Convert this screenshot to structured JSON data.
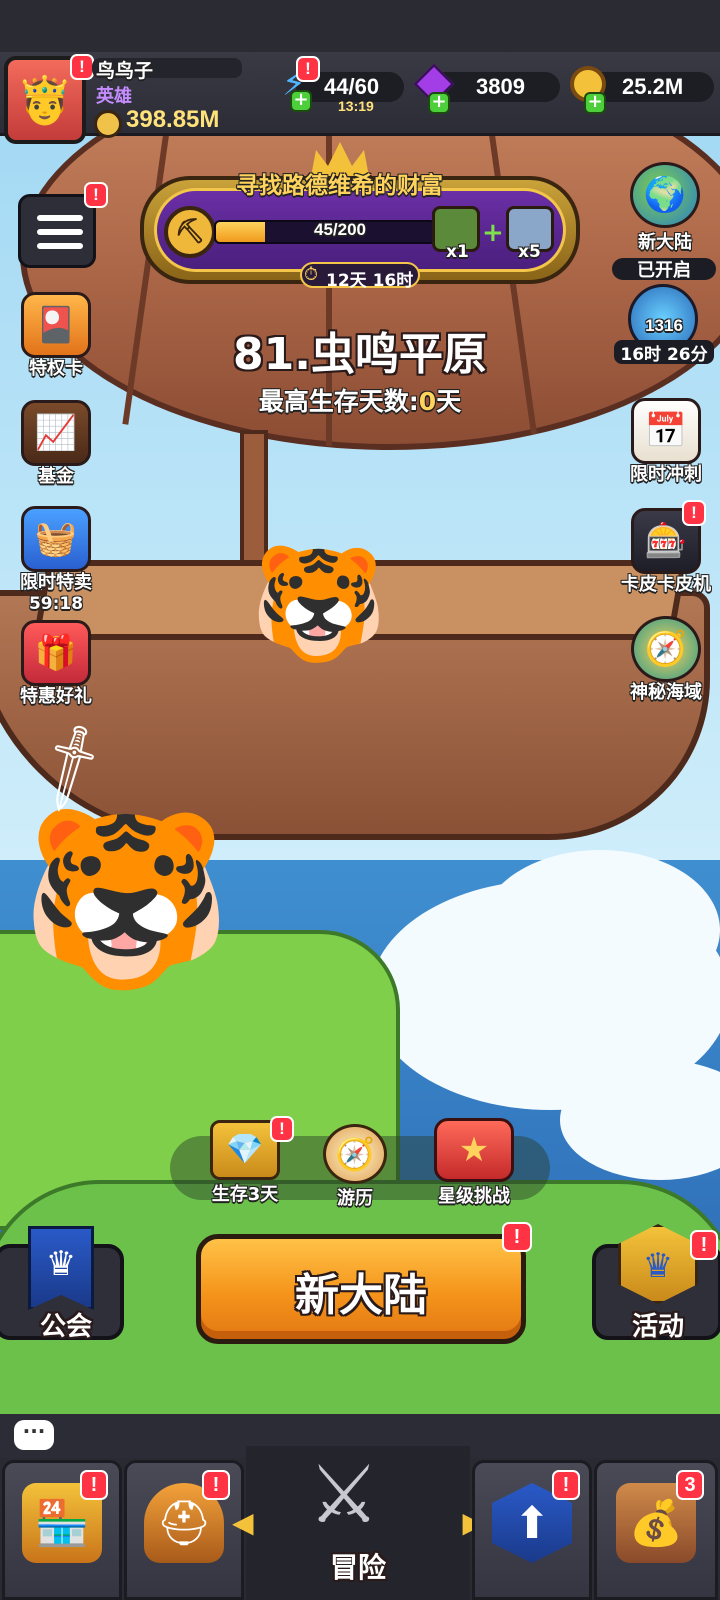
{
  "player": {
    "name": "鸟鸟子",
    "title": "英雄",
    "power": "398.85M"
  },
  "resources": {
    "energy": "44/60",
    "energy_timer": "13:19",
    "gems": "3809",
    "gold": "25.2M"
  },
  "quest": {
    "title": "寻找路德维希的财富",
    "progress_text": "45/200",
    "progress": 0.225,
    "reward1_count": "x1",
    "reward2_count": "x5",
    "timer": "12天 16时"
  },
  "stage": {
    "name": "81.虫鸣平原",
    "best_days_label": "最高生存天数:",
    "best_days_value": "0",
    "best_days_unit": "天"
  },
  "left_menu": {
    "privilege_card": "特权卡",
    "fund": "基金",
    "limited_sale": "限时特卖",
    "limited_sale_timer": "59:18",
    "special_gift": "特惠好礼"
  },
  "right_menu": {
    "new_continent": "新大陆",
    "new_continent_status": "已开启",
    "boss_count": "1316",
    "boss_timer": "16时 26分",
    "limited_sprint": "限时冲刺",
    "capybara_machine": "卡皮卡皮机",
    "mystic_sea": "神秘海域"
  },
  "actions": {
    "survive": "生存3天",
    "travel": "游历",
    "star_challenge": "星级挑战"
  },
  "main": {
    "guild": "公会",
    "start_button": "新大陆",
    "events": "活动"
  },
  "nav": {
    "adventure": "冒险",
    "chest_badge": "3"
  },
  "colors": {
    "accent_orange": "#f5941b",
    "badge_red": "#ff3344",
    "gem_purple": "#a33ee6",
    "quest_yellow": "#ffd35c"
  }
}
